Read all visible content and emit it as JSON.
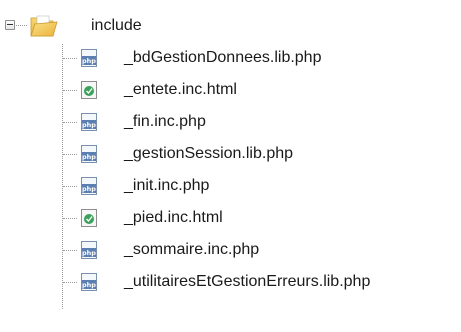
{
  "tree": {
    "folder": {
      "label": "include",
      "icon": "folder-open-icon",
      "expanded": true
    },
    "files": [
      {
        "label": "_bdGestionDonnees.lib.php",
        "icon": "php-file-icon",
        "type": "php"
      },
      {
        "label": "_entete.inc.html",
        "icon": "html-file-icon",
        "type": "html"
      },
      {
        "label": "_fin.inc.php",
        "icon": "php-file-icon",
        "type": "php"
      },
      {
        "label": "_gestionSession.lib.php",
        "icon": "php-file-icon",
        "type": "php"
      },
      {
        "label": "_init.inc.php",
        "icon": "php-file-icon",
        "type": "php"
      },
      {
        "label": "_pied.inc.html",
        "icon": "html-file-icon",
        "type": "html"
      },
      {
        "label": "_sommaire.inc.php",
        "icon": "php-file-icon",
        "type": "php"
      },
      {
        "label": "_utilitairesEtGestionErreurs.lib.php",
        "icon": "php-file-icon",
        "type": "php"
      }
    ]
  },
  "colors": {
    "php_icon_blue": "#5b7fb0",
    "html_icon_green": "#3aa05a",
    "folder_yellow": "#f2c54a",
    "guide_line": "#9a9a9a"
  }
}
